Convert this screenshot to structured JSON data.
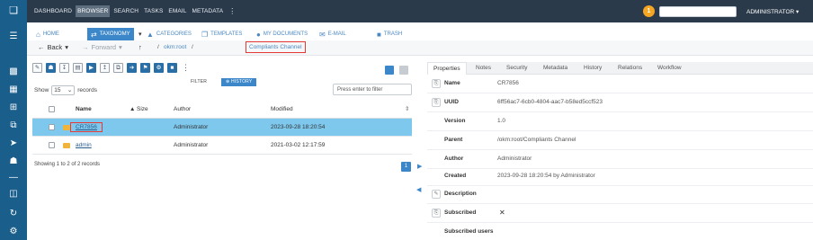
{
  "topnav": {
    "items": [
      "DASHBOARD",
      "BROWSER",
      "SEARCH",
      "TASKS",
      "EMAIL",
      "METADATA"
    ],
    "active_index": 1,
    "notification_count": "1",
    "user": "ADMINISTRATOR ▾"
  },
  "colors": {
    "topbar": "#2b3a4a",
    "sidebar": "#1a5e8c",
    "accent": "#3b87c9",
    "selected_row": "#7ec8ee",
    "highlight_box": "#e53935"
  },
  "tabs": [
    "HOME",
    "TAXONOMY",
    "CATEGORIES",
    "TEMPLATES",
    "MY DOCUMENTS",
    "E-MAIL",
    "TRASH"
  ],
  "taxonomy_chevron": "▾",
  "nav": {
    "back": "Back",
    "forward": "Forward",
    "root": "okm:root",
    "current": "Compliants Channel"
  },
  "list": {
    "show_label": "Show",
    "page_size": "15",
    "records_label": "records",
    "filter_tab": "FILTER",
    "history_tab": "HISTORY",
    "filter_placeholder": "Press enter to filter",
    "columns": {
      "name": "Name",
      "size": "Size",
      "author": "Author",
      "modified": "Modified"
    },
    "rows": [
      {
        "name": "CR7856",
        "size": "",
        "author": "Administrator",
        "modified": "2023-09-28 18:20:54",
        "selected": true
      },
      {
        "name": "admin",
        "size": "",
        "author": "Administrator",
        "modified": "2021-03-02 12:17:59",
        "selected": false
      }
    ],
    "records_info": "Showing 1 to 2 of 2 records",
    "current_page": "1"
  },
  "properties": {
    "tabs": [
      "Properties",
      "Notes",
      "Security",
      "Metadata",
      "History",
      "Relations",
      "Workflow"
    ],
    "name_label": "Name",
    "name_value": "CR7856",
    "uuid_label": "UUID",
    "uuid_value": "6ff56ac7-6cb0-4804-aac7-b58ed5ccf523",
    "version_label": "Version",
    "version_value": "1.0",
    "parent_label": "Parent",
    "parent_value": "/okm:root/Compliants Channel",
    "author_label": "Author",
    "author_value": "Administrator",
    "created_label": "Created",
    "created_value": "2023-09-28 18:20:54 by Administrator",
    "description_label": "Description",
    "subscribed_label": "Subscribed",
    "subscribed_value": "✕",
    "subscribed_users_label": "Subscribed users"
  }
}
